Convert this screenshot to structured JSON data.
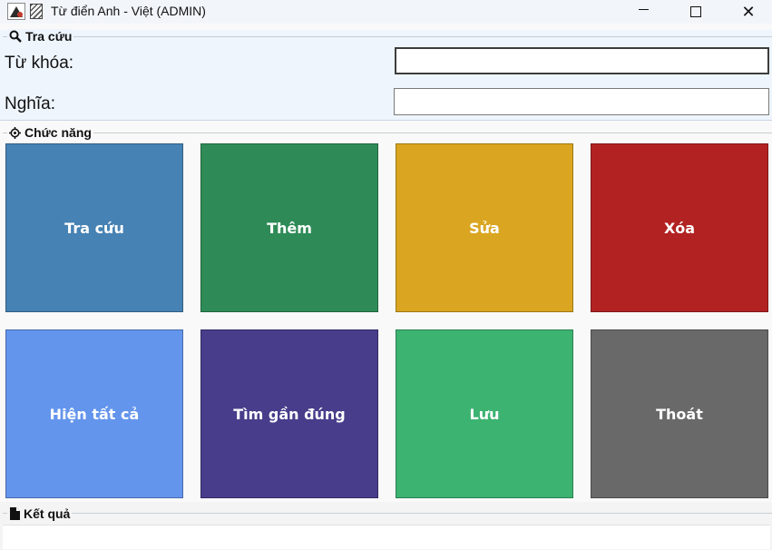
{
  "window": {
    "title": "Từ điển Anh - Việt (ADMIN)",
    "icons": [
      "app-icon",
      "document-icon",
      "minimize-icon",
      "maximize-icon",
      "close-icon"
    ],
    "close_glyph": "✕"
  },
  "search": {
    "section_label": "Tra cứu",
    "section_icon": "magnifier-icon",
    "keyword_label": "Từ khóa:",
    "keyword_value": "",
    "meaning_label": "Nghĩa:",
    "meaning_value": ""
  },
  "functions": {
    "section_label": "Chức năng",
    "section_icon": "gear-icon",
    "buttons": [
      {
        "label": "Tra cứu",
        "color": "#4682b4"
      },
      {
        "label": "Thêm",
        "color": "#2e8b57"
      },
      {
        "label": "Sửa",
        "color": "#daa520"
      },
      {
        "label": "Xóa",
        "color": "#b22222"
      },
      {
        "label": "Hiện tất cả",
        "color": "#6495ed"
      },
      {
        "label": "Tìm gần đúng",
        "color": "#483d8b"
      },
      {
        "label": "Lưu",
        "color": "#3cb371"
      },
      {
        "label": "Thoát",
        "color": "#696969"
      }
    ]
  },
  "result": {
    "section_label": "Kết quả",
    "section_icon": "document-icon",
    "content": ""
  }
}
